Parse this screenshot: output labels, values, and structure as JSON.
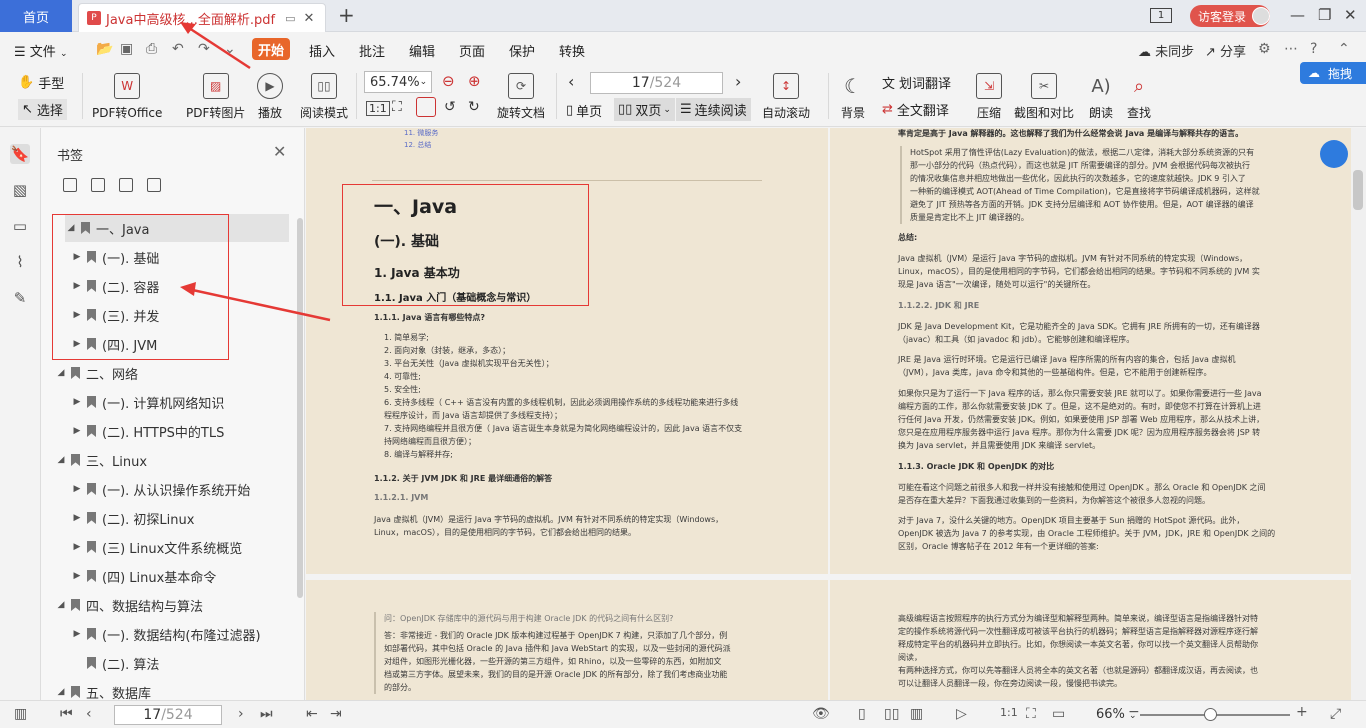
{
  "titlebar": {
    "home_tab": "首页",
    "doc_tab": "Java中高级核...全面解析.pdf",
    "pdf_badge": "P",
    "login_label": "访客登录"
  },
  "menubar": {
    "file": "文件",
    "start": "开始",
    "items": [
      "插入",
      "批注",
      "编辑",
      "页面",
      "保护",
      "转换"
    ],
    "sync": "未同步",
    "share": "分享"
  },
  "toolbar": {
    "hand": "手型",
    "select": "选择",
    "pdf_to_office": "PDF转Office",
    "pdf_to_image": "PDF转图片",
    "play": "播放",
    "read_mode": "阅读模式",
    "zoom": "65.74%",
    "rotate": "旋转文档",
    "page_current": "17",
    "page_total": "/524",
    "single": "单页",
    "double": "双页",
    "continuous": "连续阅读",
    "autoscroll": "自动滚动",
    "background": "背景",
    "word_translate": "划词翻译",
    "full_translate": "全文翻译",
    "compress": "压缩",
    "screenshot_compare": "截图和对比",
    "read_aloud": "朗读",
    "find": "查找",
    "translate_badge": "拖拽"
  },
  "bookmarks": {
    "title": "书签",
    "items": [
      {
        "label": "一、Java",
        "level": 0
      },
      {
        "label": "(一). 基础",
        "level": 1
      },
      {
        "label": "(二). 容器",
        "level": 1
      },
      {
        "label": "(三). 并发",
        "level": 1
      },
      {
        "label": "(四). JVM",
        "level": 1
      },
      {
        "label": "二、网络",
        "level": 0
      },
      {
        "label": "(一). 计算机网络知识",
        "level": 1
      },
      {
        "label": "(二). HTTPS中的TLS",
        "level": 1
      },
      {
        "label": "三、Linux",
        "level": 0
      },
      {
        "label": "(一). 从认识操作系统开始",
        "level": 1
      },
      {
        "label": "(二). 初探Linux",
        "level": 1
      },
      {
        "label": "(三) Linux文件系统概览",
        "level": 1
      },
      {
        "label": "(四) Linux基本命令",
        "level": 1
      },
      {
        "label": "四、数据结构与算法",
        "level": 0
      },
      {
        "label": "(一). 数据结构(布隆过滤器)",
        "level": 1
      },
      {
        "label": "(二). 算法",
        "level": 1
      },
      {
        "label": "五、数据库",
        "level": 0
      }
    ]
  },
  "pageL": {
    "toc1": "11. 微服务",
    "toc2": "12. 总结",
    "h1": "一、Java",
    "h2": "(一). 基础",
    "h3": "1. Java 基本功",
    "h4": "1.1. Java 入门（基础概念与常识）",
    "h5": "1.1.1. Java 语言有哪些特点?",
    "list": [
      "1. 简单易学;",
      "2. 面向对象（封装，继承，多态）；",
      "3. 平台无关性（Java 虚拟机实现平台无关性）；",
      "4. 可靠性;",
      "5. 安全性;",
      "6. 支持多线程（ C++ 语言没有内置的多线程机制，因此必须调用操作系统的多线程功能来进行多线",
      "   程程序设计，而 Java 语言却提供了多线程支持）；",
      "7. 支持网络编程并且很方便（ Java 语言诞生本身就是为简化网络编程设计的，因此 Java 语言不仅支",
      "   持网络编程而且很方便）；",
      "8. 编译与解释并存;"
    ],
    "h6": "1.1.2. 关于 JVM JDK 和 JRE 最详细通俗的解答",
    "h7": "1.1.2.1. JVM",
    "p1": "Java 虚拟机（JVM）是运行 Java 字节码的虚拟机。JVM 有针对不同系统的特定实现（Windows，",
    "p2": "Linux，macOS），目的是使用相同的字节码，它们都会给出相同的结果。"
  },
  "pageR": {
    "top": "率肯定是高于 Java 解释器的。这也解释了我们为什么经常会说 Java 是编译与解释共存的语言。",
    "quote": [
      "HotSpot 采用了惰性评估(Lazy Evaluation)的做法，根据二八定律，消耗大部分系统资源的只有",
      "那一小部分的代码（热点代码），而这也就是 JIT 所需要编译的部分。JVM 会根据代码每次被执行",
      "的情况收集信息并相应地做出一些优化，因此执行的次数越多，它的速度就越快。JDK 9 引入了",
      "一种新的编译模式 AOT(Ahead of Time Compilation)，它是直接将字节码编译成机器码，这样就",
      "避免了 JIT 预热等各方面的开销。JDK 支持分层编译和 AOT 协作使用。但是，AOT 编译器的编译",
      "质量是肯定比不上 JIT 编译器的。"
    ],
    "summary": "总结:",
    "s1": "Java 虚拟机（JVM）是运行 Java 字节码的虚拟机。JVM 有针对不同系统的特定实现（Windows，",
    "s2": "Linux，macOS），目的是使用相同的字节码，它们都会给出相同的结果。字节码和不同系统的 JVM 实",
    "s3": "现是 Java 语言\"一次编译，随处可以运行\"的关键所在。",
    "h1": "1.1.2.2. JDK 和 JRE",
    "j1": "JDK 是 Java Development Kit，它是功能齐全的 Java SDK。它拥有 JRE 所拥有的一切，还有编译器",
    "j2": "（javac）和工具（如 javadoc 和 jdb）。它能够创建和编译程序。",
    "j3": "JRE 是 Java 运行时环境。它是运行已编译 Java 程序所需的所有内容的集合，包括 Java 虚拟机",
    "j4": "（JVM），Java 类库，java 命令和其他的一些基础构件。但是，它不能用于创建新程序。",
    "k1": "如果你只是为了运行一下 Java 程序的话，那么你只需要安装 JRE 就可以了。如果你需要进行一些 Java",
    "k2": "编程方面的工作，那么你就需要安装 JDK 了。但是，这不是绝对的。有时，即使您不打算在计算机上进",
    "k3": "行任何 Java 开发，仍然需要安装 JDK。例如，如果要使用 JSP 部署 Web 应用程序，那么从技术上讲，",
    "k4": "您只是在应用程序服务器中运行 Java 程序。那你为什么需要 JDK 呢？因为应用程序服务器会将 JSP 转",
    "k5": "换为 Java servlet，并且需要使用 JDK 来编译 servlet。",
    "h2": "1.1.3. Oracle JDK 和 OpenJDK 的对比",
    "o1": "可能在看这个问题之前很多人和我一样并没有接触和使用过 OpenJDK 。那么 Oracle 和 OpenJDK 之间",
    "o2": "是否存在重大差异？下面我通过收集到的一些资料，为你解答这个被很多人忽视的问题。",
    "o3": "对于 Java 7，没什么关键的地方。OpenJDK 项目主要基于 Sun 捐赠的 HotSpot 源代码。此外，",
    "o4": "OpenJDK 被选为 Java 7 的参考实现，由 Oracle 工程师维护。关于 JVM，JDK，JRE 和 OpenJDK 之间的",
    "o5": "区别，Oracle 博客帖子在 2012 年有一个更详细的答案:"
  },
  "pageL2": {
    "q": "问：OpenJDK 存储库中的源代码与用于构建 Oracle JDK 的代码之间有什么区别?",
    "a": [
      "答：非常接近 - 我们的 Oracle JDK 版本构建过程基于 OpenJDK 7 构建，只添加了几个部分，例",
      "如部署代码，其中包括 Oracle 的 Java 插件和 Java WebStart 的实现，以及一些封闭的源代码派",
      "对组件，如图形光栅化器，一些开源的第三方组件，如 Rhino，以及一些零碎的东西，如附加文",
      "档或第三方字体。展望未来，我们的目的是开源 Oracle JDK 的所有部分，除了我们考虑商业功能",
      "的部分。"
    ]
  },
  "pageR2": {
    "lines": [
      "高级编程语言按照程序的执行方式分为编译型和解释型两种。简单来说，编译型语言是指编译器针对特",
      "定的操作系统将源代码一次性翻译成可被该平台执行的机器码；解释型语言是指解释器对源程序逐行解",
      "释成特定平台的机器码并立即执行。比如，你想阅读一本英文名著，你可以找一个英文翻译人员帮助你",
      "阅读，",
      "有两种选择方式，你可以先等翻译人员将全本的英文名著（也就是源码）都翻译成汉语，再去阅读，也",
      "可以让翻译人员翻译一段，你在旁边阅读一段，慢慢把书读完。"
    ]
  },
  "statusbar": {
    "page_current": "17",
    "page_total": "/524",
    "zoom": "66%"
  }
}
